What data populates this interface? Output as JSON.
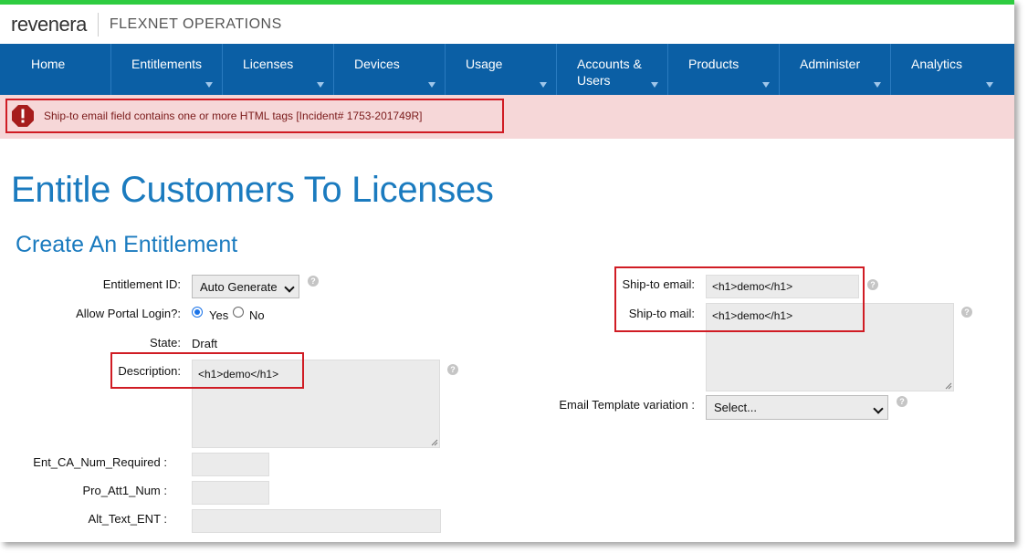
{
  "brand": {
    "logo": "revenera",
    "product": "FLEXNET OPERATIONS"
  },
  "nav": [
    {
      "label": "Home"
    },
    {
      "label": "Entitlements"
    },
    {
      "label": "Licenses"
    },
    {
      "label": "Devices"
    },
    {
      "label": "Usage"
    },
    {
      "label": "Accounts &\nUsers"
    },
    {
      "label": "Products"
    },
    {
      "label": "Administer"
    },
    {
      "label": "Analytics"
    }
  ],
  "alert": {
    "message": "Ship-to email field contains one or more HTML tags [Incident# 1753-201749R]"
  },
  "page": {
    "title": "Entitle Customers To Licenses",
    "section": "Create An Entitlement"
  },
  "form": {
    "entitlement_id": {
      "label": "Entitlement ID:",
      "value": "Auto Generate"
    },
    "portal_login": {
      "label": "Allow Portal Login?:",
      "yes": "Yes",
      "no": "No",
      "selected": "Yes"
    },
    "state": {
      "label": "State:",
      "value": "Draft"
    },
    "description": {
      "label": "Description:",
      "value": "<h1>demo</h1>"
    },
    "ent_ca": {
      "label": "Ent_CA_Num_Required :",
      "value": ""
    },
    "pro_att": {
      "label": "Pro_Att1_Num :",
      "value": ""
    },
    "alt_text": {
      "label": "Alt_Text_ENT :",
      "value": ""
    },
    "ship_email": {
      "label": "Ship-to email:",
      "value": "<h1>demo</h1>"
    },
    "ship_mail": {
      "label": "Ship-to mail:",
      "value": "<h1>demo</h1>"
    },
    "email_template": {
      "label": "Email Template variation :",
      "value": "Select..."
    }
  },
  "help_glyph": "?",
  "colors": {
    "accent_green": "#2ecc40",
    "nav_blue": "#0b5fa5",
    "alert_bg": "#f6d7d8",
    "highlight_red": "#d01c24",
    "title_blue": "#1b7bbf"
  }
}
